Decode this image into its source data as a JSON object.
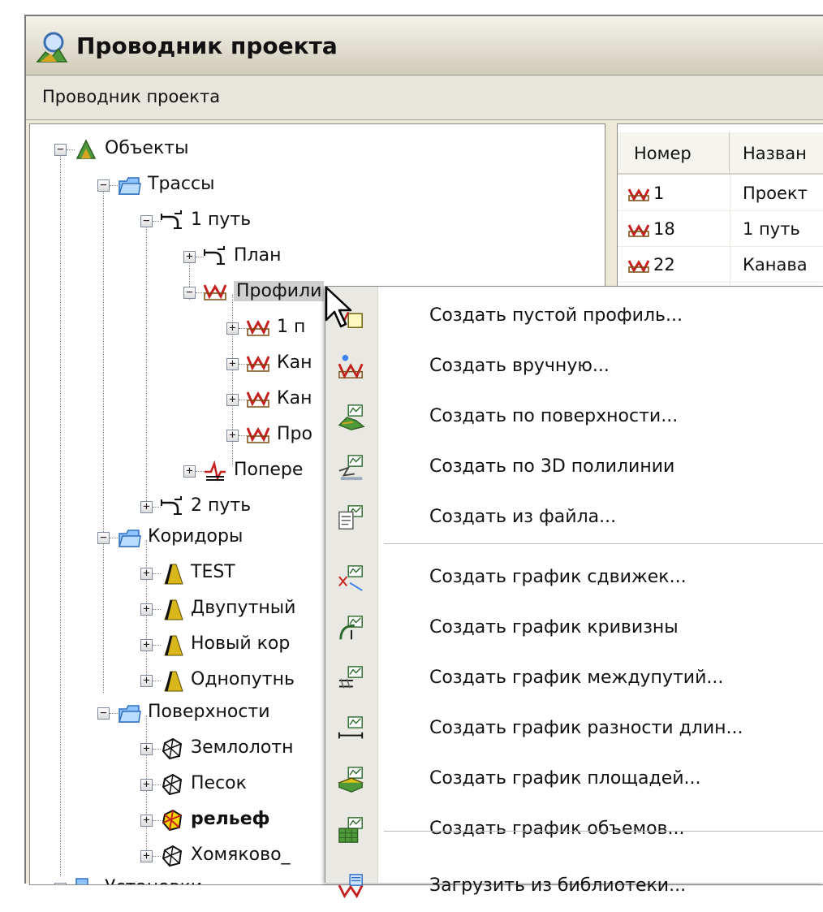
{
  "window": {
    "title": "Проводник проекта",
    "subheader": "Проводник проекта"
  },
  "tree": {
    "items": [
      {
        "label": "Объекты",
        "icon": "objects-icon",
        "expander": "−"
      },
      {
        "label": "Трассы",
        "icon": "folder-icon",
        "expander": "−"
      },
      {
        "label": "1 путь",
        "icon": "alignment-icon",
        "expander": "−"
      },
      {
        "label": "План",
        "icon": "alignment-icon",
        "expander": "+"
      },
      {
        "label": "Профили",
        "icon": "profile-icon",
        "expander": "−"
      },
      {
        "label": "1 п",
        "icon": "profile-icon",
        "expander": "+"
      },
      {
        "label": "Кан",
        "icon": "profile-icon",
        "expander": "+"
      },
      {
        "label": "Кан",
        "icon": "profile-icon",
        "expander": "+"
      },
      {
        "label": "Про",
        "icon": "profile-icon",
        "expander": "+"
      },
      {
        "label": "Попере",
        "icon": "cross-section-icon",
        "expander": "+"
      },
      {
        "label": "2 путь",
        "icon": "alignment-icon",
        "expander": "+"
      },
      {
        "label": "Коридоры",
        "icon": "folder-icon",
        "expander": "−"
      },
      {
        "label": "TEST",
        "icon": "corridor-icon",
        "expander": "+"
      },
      {
        "label": "Двупутный",
        "icon": "corridor-icon",
        "expander": "+"
      },
      {
        "label": "Новый кор",
        "icon": "corridor-icon",
        "expander": "+"
      },
      {
        "label": "Однопутнь",
        "icon": "corridor-icon",
        "expander": "+"
      },
      {
        "label": "Поверхности",
        "icon": "folder-icon",
        "expander": "−"
      },
      {
        "label": "Землолотн",
        "icon": "surface-icon",
        "expander": "+"
      },
      {
        "label": "Песок",
        "icon": "surface-icon",
        "expander": "+"
      },
      {
        "label": "рельеф",
        "icon": "surface-active-icon",
        "expander": "+"
      },
      {
        "label": "Хомяково_",
        "icon": "surface-icon",
        "expander": "+"
      },
      {
        "label": "Установки",
        "icon": "settings-icon",
        "expander": "−"
      }
    ]
  },
  "list": {
    "columns": [
      "Номер",
      "Назван"
    ],
    "rows": [
      {
        "number": "1",
        "name": "Проект"
      },
      {
        "number": "18",
        "name": "1 путь"
      },
      {
        "number": "22",
        "name": "Канава"
      }
    ]
  },
  "context_menu": {
    "items": [
      {
        "label": "Создать пустой профиль...",
        "icon": "new-empty-profile-icon"
      },
      {
        "label": "Создать вручную...",
        "icon": "create-manual-icon"
      },
      {
        "label": "Создать по поверхности...",
        "icon": "profile-from-surface-icon"
      },
      {
        "label": "Создать по 3D полилинии",
        "icon": "profile-from-3d-polyline-icon"
      },
      {
        "label": "Создать из файла...",
        "icon": "profile-from-file-icon"
      },
      {
        "label": "Создать график сдвижек...",
        "icon": "shift-graph-icon"
      },
      {
        "label": "Создать график кривизны",
        "icon": "curvature-graph-icon"
      },
      {
        "label": "Создать график междупутий...",
        "icon": "track-spacing-graph-icon"
      },
      {
        "label": "Создать график разности длин...",
        "icon": "length-difference-graph-icon"
      },
      {
        "label": "Создать график площадей...",
        "icon": "area-graph-icon"
      },
      {
        "label": "Создать график объемов...",
        "icon": "volume-graph-icon"
      },
      {
        "label": "Загрузить из библиотеки...",
        "icon": "load-from-library-icon"
      }
    ]
  }
}
